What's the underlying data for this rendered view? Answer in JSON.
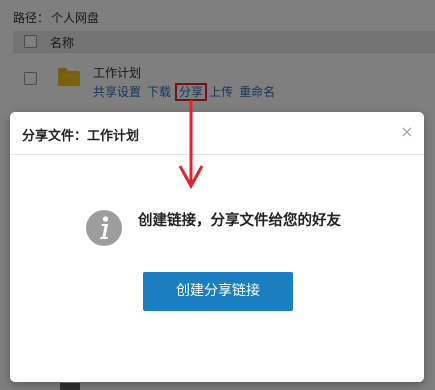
{
  "breadcrumb": {
    "label": "路径：",
    "location": "个人网盘"
  },
  "table": {
    "header": {
      "name_col": "名称"
    }
  },
  "file": {
    "name": "工作计划",
    "actions": {
      "share_settings": "共享设置",
      "download": "下载",
      "share": "分享",
      "upload": "上传",
      "rename": "重命名"
    }
  },
  "dialog": {
    "title": "分享文件：工作计划",
    "close": "×",
    "message": "创建链接，分享文件给您的好友",
    "button": "创建分享链接"
  },
  "colors": {
    "accent": "#1a7fc1",
    "annotation": "#e0242e",
    "link": "#2a6cb6",
    "folder": "#f0b614"
  }
}
